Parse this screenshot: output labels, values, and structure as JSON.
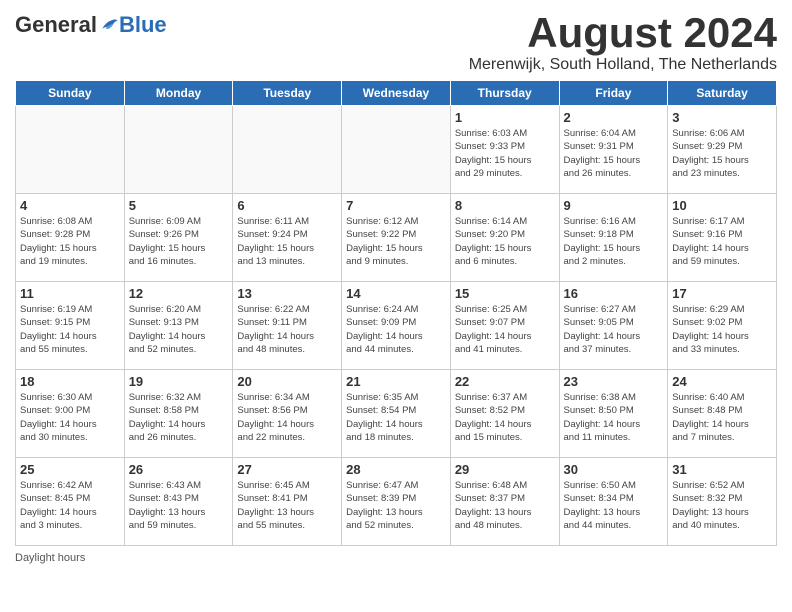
{
  "header": {
    "logo_general": "General",
    "logo_blue": "Blue",
    "month_title": "August 2024",
    "location": "Merenwijk, South Holland, The Netherlands"
  },
  "days_of_week": [
    "Sunday",
    "Monday",
    "Tuesday",
    "Wednesday",
    "Thursday",
    "Friday",
    "Saturday"
  ],
  "weeks": [
    [
      {
        "day": "",
        "info": ""
      },
      {
        "day": "",
        "info": ""
      },
      {
        "day": "",
        "info": ""
      },
      {
        "day": "",
        "info": ""
      },
      {
        "day": "1",
        "info": "Sunrise: 6:03 AM\nSunset: 9:33 PM\nDaylight: 15 hours\nand 29 minutes."
      },
      {
        "day": "2",
        "info": "Sunrise: 6:04 AM\nSunset: 9:31 PM\nDaylight: 15 hours\nand 26 minutes."
      },
      {
        "day": "3",
        "info": "Sunrise: 6:06 AM\nSunset: 9:29 PM\nDaylight: 15 hours\nand 23 minutes."
      }
    ],
    [
      {
        "day": "4",
        "info": "Sunrise: 6:08 AM\nSunset: 9:28 PM\nDaylight: 15 hours\nand 19 minutes."
      },
      {
        "day": "5",
        "info": "Sunrise: 6:09 AM\nSunset: 9:26 PM\nDaylight: 15 hours\nand 16 minutes."
      },
      {
        "day": "6",
        "info": "Sunrise: 6:11 AM\nSunset: 9:24 PM\nDaylight: 15 hours\nand 13 minutes."
      },
      {
        "day": "7",
        "info": "Sunrise: 6:12 AM\nSunset: 9:22 PM\nDaylight: 15 hours\nand 9 minutes."
      },
      {
        "day": "8",
        "info": "Sunrise: 6:14 AM\nSunset: 9:20 PM\nDaylight: 15 hours\nand 6 minutes."
      },
      {
        "day": "9",
        "info": "Sunrise: 6:16 AM\nSunset: 9:18 PM\nDaylight: 15 hours\nand 2 minutes."
      },
      {
        "day": "10",
        "info": "Sunrise: 6:17 AM\nSunset: 9:16 PM\nDaylight: 14 hours\nand 59 minutes."
      }
    ],
    [
      {
        "day": "11",
        "info": "Sunrise: 6:19 AM\nSunset: 9:15 PM\nDaylight: 14 hours\nand 55 minutes."
      },
      {
        "day": "12",
        "info": "Sunrise: 6:20 AM\nSunset: 9:13 PM\nDaylight: 14 hours\nand 52 minutes."
      },
      {
        "day": "13",
        "info": "Sunrise: 6:22 AM\nSunset: 9:11 PM\nDaylight: 14 hours\nand 48 minutes."
      },
      {
        "day": "14",
        "info": "Sunrise: 6:24 AM\nSunset: 9:09 PM\nDaylight: 14 hours\nand 44 minutes."
      },
      {
        "day": "15",
        "info": "Sunrise: 6:25 AM\nSunset: 9:07 PM\nDaylight: 14 hours\nand 41 minutes."
      },
      {
        "day": "16",
        "info": "Sunrise: 6:27 AM\nSunset: 9:05 PM\nDaylight: 14 hours\nand 37 minutes."
      },
      {
        "day": "17",
        "info": "Sunrise: 6:29 AM\nSunset: 9:02 PM\nDaylight: 14 hours\nand 33 minutes."
      }
    ],
    [
      {
        "day": "18",
        "info": "Sunrise: 6:30 AM\nSunset: 9:00 PM\nDaylight: 14 hours\nand 30 minutes."
      },
      {
        "day": "19",
        "info": "Sunrise: 6:32 AM\nSunset: 8:58 PM\nDaylight: 14 hours\nand 26 minutes."
      },
      {
        "day": "20",
        "info": "Sunrise: 6:34 AM\nSunset: 8:56 PM\nDaylight: 14 hours\nand 22 minutes."
      },
      {
        "day": "21",
        "info": "Sunrise: 6:35 AM\nSunset: 8:54 PM\nDaylight: 14 hours\nand 18 minutes."
      },
      {
        "day": "22",
        "info": "Sunrise: 6:37 AM\nSunset: 8:52 PM\nDaylight: 14 hours\nand 15 minutes."
      },
      {
        "day": "23",
        "info": "Sunrise: 6:38 AM\nSunset: 8:50 PM\nDaylight: 14 hours\nand 11 minutes."
      },
      {
        "day": "24",
        "info": "Sunrise: 6:40 AM\nSunset: 8:48 PM\nDaylight: 14 hours\nand 7 minutes."
      }
    ],
    [
      {
        "day": "25",
        "info": "Sunrise: 6:42 AM\nSunset: 8:45 PM\nDaylight: 14 hours\nand 3 minutes."
      },
      {
        "day": "26",
        "info": "Sunrise: 6:43 AM\nSunset: 8:43 PM\nDaylight: 13 hours\nand 59 minutes."
      },
      {
        "day": "27",
        "info": "Sunrise: 6:45 AM\nSunset: 8:41 PM\nDaylight: 13 hours\nand 55 minutes."
      },
      {
        "day": "28",
        "info": "Sunrise: 6:47 AM\nSunset: 8:39 PM\nDaylight: 13 hours\nand 52 minutes."
      },
      {
        "day": "29",
        "info": "Sunrise: 6:48 AM\nSunset: 8:37 PM\nDaylight: 13 hours\nand 48 minutes."
      },
      {
        "day": "30",
        "info": "Sunrise: 6:50 AM\nSunset: 8:34 PM\nDaylight: 13 hours\nand 44 minutes."
      },
      {
        "day": "31",
        "info": "Sunrise: 6:52 AM\nSunset: 8:32 PM\nDaylight: 13 hours\nand 40 minutes."
      }
    ]
  ],
  "footer": {
    "note": "Daylight hours"
  }
}
